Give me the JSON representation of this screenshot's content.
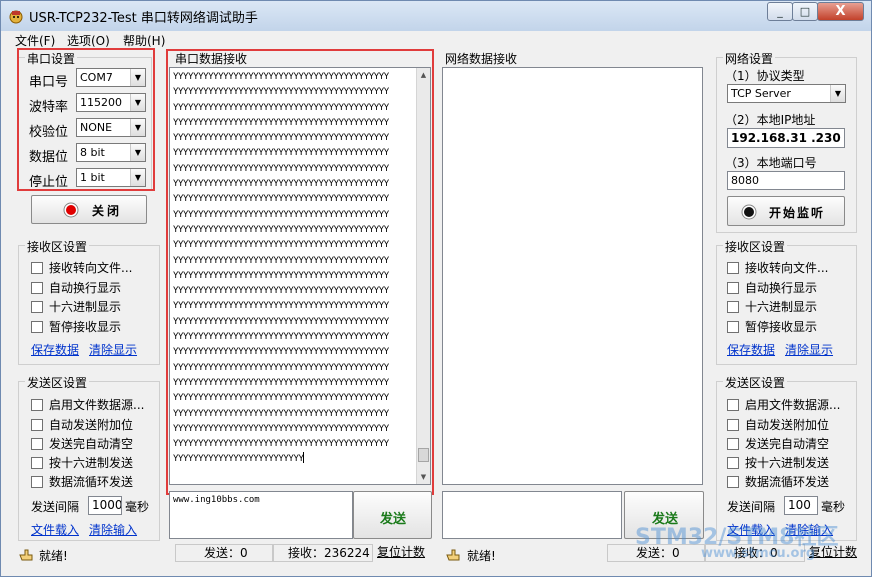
{
  "window": {
    "title": "USR-TCP232-Test 串口转网络调试助手",
    "controls": {
      "minimize": "_",
      "maximize": "□",
      "close": "X"
    }
  },
  "menu": [
    "文件(F)",
    "选项(O)",
    "帮助(H)"
  ],
  "serial_settings": {
    "title": "串口设置",
    "fields": [
      {
        "label": "串口号",
        "value": "COM7"
      },
      {
        "label": "波特率",
        "value": "115200"
      },
      {
        "label": "校验位",
        "value": "NONE"
      },
      {
        "label": "数据位",
        "value": "8 bit"
      },
      {
        "label": "停止位",
        "value": "1 bit"
      }
    ],
    "close_button": "关闭"
  },
  "left_receive": {
    "title": "接收区设置",
    "options": [
      "接收转向文件...",
      "自动换行显示",
      "十六进制显示",
      "暂停接收显示"
    ],
    "save_link": "保存数据",
    "clear_link": "清除显示"
  },
  "left_send": {
    "title": "发送区设置",
    "options": [
      "启用文件数据源...",
      "自动发送附加位",
      "发送完自动清空",
      "按十六进制发送",
      "数据流循环发送"
    ],
    "interval_label": "发送间隔",
    "interval_value": "1000",
    "interval_unit": "毫秒",
    "load_link": "文件载入",
    "clear_link": "清除输入"
  },
  "serial_rx": {
    "title": "串口数据接收",
    "line": "YYYYYYYYYYYYYYYYYYYYYYYYYYYYYYYYYYYYYYYYYYY",
    "full_line_count": 25,
    "last_line": "YYYYYYYYYYYYYYYYYYYYYYYYYY"
  },
  "net_rx": {
    "title": "网络数据接收"
  },
  "serial_tx": {
    "value": "www.ing10bbs.com",
    "send_button": "发送"
  },
  "net_tx": {
    "value": "",
    "send_button": "发送"
  },
  "status_left": {
    "ready": "就绪!",
    "send": "发送：0",
    "receive": "接收：236224",
    "reset": "复位计数"
  },
  "status_right": {
    "ready": "就绪!",
    "send": "发送：0",
    "receive": "接收：0",
    "reset": "复位计数"
  },
  "network_settings": {
    "title": "网络设置",
    "protocol_label": "（1）协议类型",
    "protocol_value": "TCP Server",
    "ip_label": "（2）本地IP地址",
    "ip_value": "192.168.31 .230",
    "port_label": "（3）本地端口号",
    "port_value": "8080",
    "listen_button": "开始监听"
  },
  "right_receive": {
    "title": "接收区设置",
    "options": [
      "接收转向文件...",
      "自动换行显示",
      "十六进制显示",
      "暂停接收显示"
    ],
    "save_link": "保存数据",
    "clear_link": "清除显示"
  },
  "right_send": {
    "title": "发送区设置",
    "options": [
      "启用文件数据源...",
      "自动发送附加位",
      "发送完自动清空",
      "按十六进制发送",
      "数据流循环发送"
    ],
    "interval_label": "发送间隔",
    "interval_value": "100",
    "interval_unit": "毫秒",
    "load_link": "文件载入",
    "clear_link": "清除输入"
  },
  "watermark": {
    "main": "STM32/STM8社区",
    "url": "www.stmcu.org"
  },
  "colors": {
    "highlight_frame": "#e03c3c",
    "send_button_text": "#1a7a1a",
    "link": "#0033cc",
    "active_indicator": "#e00000"
  }
}
